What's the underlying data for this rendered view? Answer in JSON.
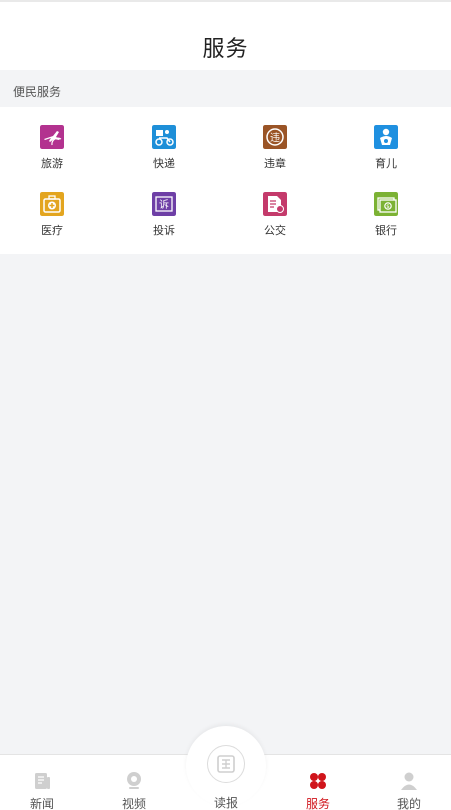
{
  "header": {
    "title": "服务"
  },
  "section": {
    "label": "便民服务"
  },
  "services": [
    {
      "label": "旅游",
      "icon": "plane-icon",
      "color": "#b3328f"
    },
    {
      "label": "快递",
      "icon": "delivery-bike-icon",
      "color": "#1e8fd8"
    },
    {
      "label": "违章",
      "icon": "violation-icon",
      "color": "#9a5426"
    },
    {
      "label": "育儿",
      "icon": "baby-icon",
      "color": "#1f90e0"
    },
    {
      "label": "医疗",
      "icon": "medical-kit-icon",
      "color": "#e3a51f"
    },
    {
      "label": "投诉",
      "icon": "complaint-icon",
      "color": "#6e3fa6"
    },
    {
      "label": "公交",
      "icon": "bus-card-icon",
      "color": "#c43a6b"
    },
    {
      "label": "银行",
      "icon": "bank-money-icon",
      "color": "#7cb234"
    }
  ],
  "tabbar": {
    "items": [
      {
        "label": "新闻",
        "icon": "news-icon"
      },
      {
        "label": "视频",
        "icon": "video-icon"
      },
      {
        "label": "读报",
        "icon": "newspaper-icon"
      },
      {
        "label": "服务",
        "icon": "services-icon",
        "active": true
      },
      {
        "label": "我的",
        "icon": "user-icon"
      }
    ],
    "active_color": "#d0141b",
    "inactive_color": "#cfcfcf"
  }
}
